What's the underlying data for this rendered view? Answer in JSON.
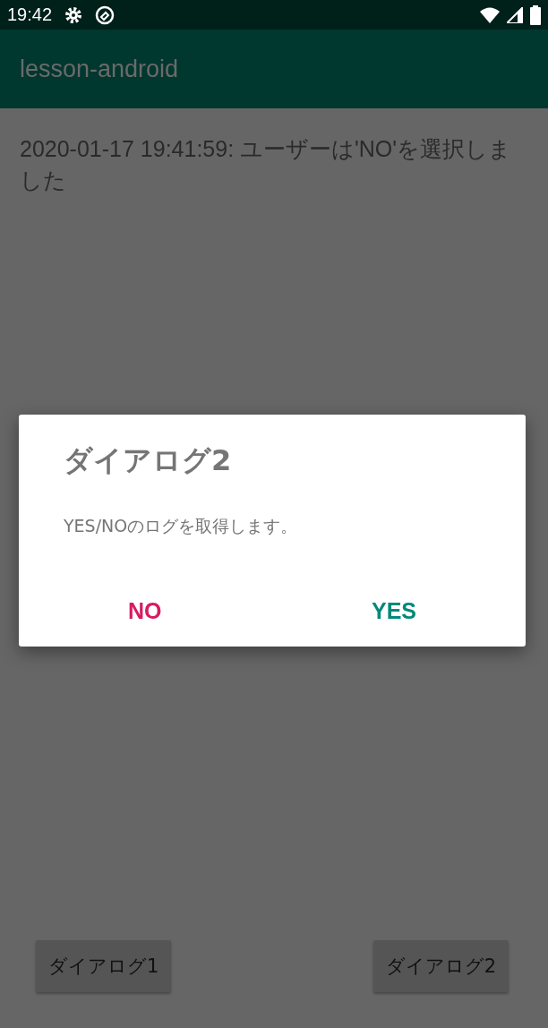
{
  "status_bar": {
    "time": "19:42"
  },
  "app_bar": {
    "title": "lesson-android"
  },
  "log_text": "2020-01-17 19:41:59: ユーザーは'NO'を選択しました",
  "dialog": {
    "title": "ダイアログ2",
    "message": "YES/NOのログを取得します。",
    "buttons": [
      {
        "label": "NO",
        "kind": "negative"
      },
      {
        "label": "YES",
        "kind": "positive"
      }
    ]
  },
  "buttons": [
    "ダイアログ1",
    "ダイアログ2"
  ]
}
